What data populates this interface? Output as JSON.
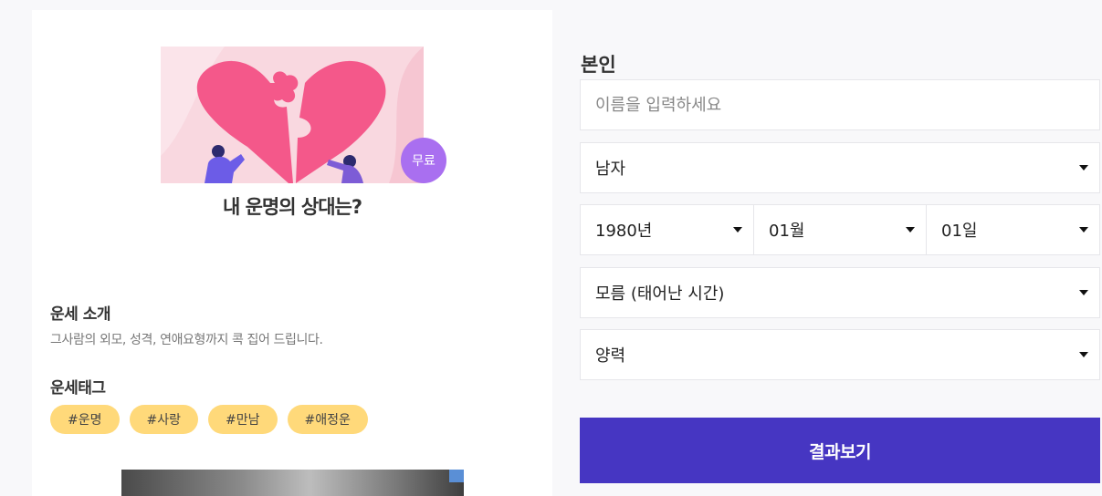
{
  "product": {
    "badge": "무료",
    "title": "내 운명의 상대는?"
  },
  "intro": {
    "heading": "운세 소개",
    "text": "그사람의 외모, 성격, 연애요형까지 콕 집어 드립니다."
  },
  "tags": {
    "heading": "운세태그",
    "items": [
      "#운명",
      "#사랑",
      "#만남",
      "#애정운"
    ]
  },
  "form": {
    "section_label": "본인",
    "name_placeholder": "이름을 입력하세요",
    "gender": "남자",
    "year": "1980년",
    "month": "01월",
    "day": "01일",
    "birth_time": "모름 (태어난 시간)",
    "calendar": "양력",
    "submit_label": "결과보기"
  },
  "colors": {
    "accent": "#4636c2",
    "badge": "#a96ff0",
    "tag": "#ffd97a",
    "heart": "#f4588a"
  }
}
